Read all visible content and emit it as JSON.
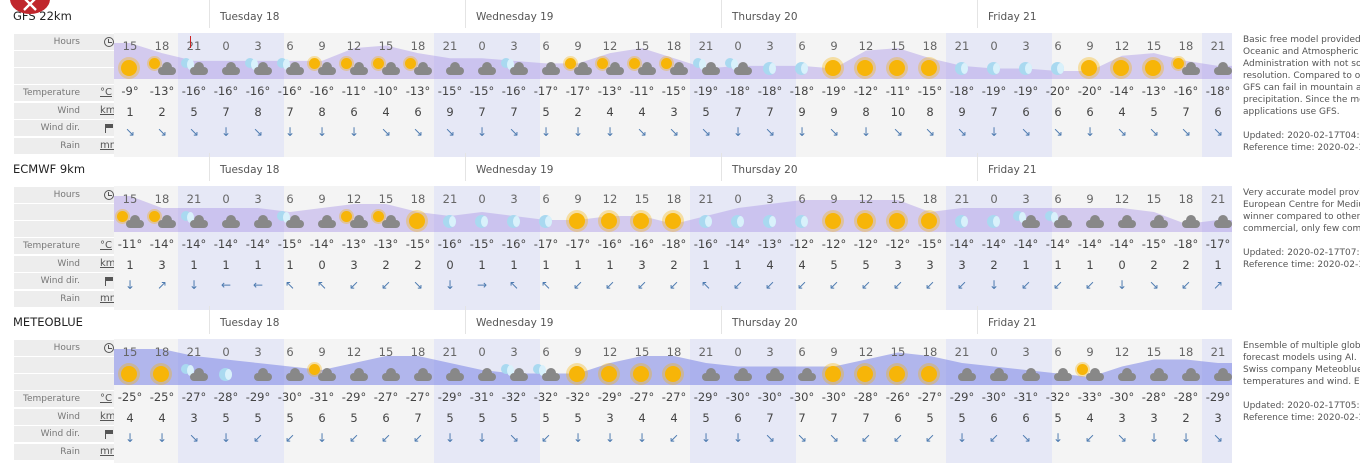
{
  "page": {
    "close_label": "close"
  },
  "days": [
    "Tuesday 18",
    "Wednesday 19",
    "Thursday 20",
    "Friday 21"
  ],
  "labels": {
    "hours": "Hours",
    "temperature": "Temperature",
    "temp_unit": "°C",
    "wind": "Wind",
    "wind_unit": "km/h",
    "wind_dir": "Wind dir.",
    "rain": "Rain",
    "rain_unit": "mm"
  },
  "hours": [
    "15",
    "18",
    "21",
    "0",
    "3",
    "6",
    "9",
    "12",
    "15",
    "18",
    "21",
    "0",
    "3",
    "6",
    "9",
    "12",
    "15",
    "18",
    "21",
    "0",
    "3",
    "6",
    "9",
    "12",
    "15",
    "18",
    "21",
    "0",
    "3",
    "6",
    "9",
    "12",
    "15",
    "18",
    "21"
  ],
  "models": [
    {
      "name": "GFS 22km",
      "temps": [
        "-9°",
        "-13°",
        "-16°",
        "-16°",
        "-16°",
        "-16°",
        "-16°",
        "-11°",
        "-10°",
        "-13°",
        "-15°",
        "-15°",
        "-16°",
        "-17°",
        "-17°",
        "-13°",
        "-11°",
        "-15°",
        "-19°",
        "-18°",
        "-18°",
        "-18°",
        "-19°",
        "-12°",
        "-11°",
        "-15°",
        "-18°",
        "-19°",
        "-19°",
        "-20°",
        "-20°",
        "-14°",
        "-13°",
        "-16°",
        "-18°"
      ],
      "wind": [
        "1",
        "2",
        "5",
        "7",
        "8",
        "7",
        "8",
        "6",
        "4",
        "6",
        "9",
        "7",
        "7",
        "5",
        "2",
        "4",
        "4",
        "3",
        "5",
        "7",
        "7",
        "9",
        "9",
        "8",
        "10",
        "8",
        "9",
        "7",
        "6",
        "6",
        "6",
        "4",
        "5",
        "7",
        "6"
      ],
      "icons": [
        "sun",
        "pcd",
        "pcn",
        "cloud",
        "pcn",
        "pcn",
        "pcd",
        "pcd",
        "pcd",
        "pcd",
        "cloud",
        "cloud",
        "pcn",
        "cloud",
        "pcd",
        "pcd",
        "pcd",
        "pcd",
        "pcn",
        "pcn",
        "moon",
        "moon",
        "sun",
        "sun",
        "sun",
        "sun",
        "moon",
        "moon",
        "moon",
        "moon",
        "sun",
        "sun",
        "sun",
        "pcd",
        "cloud"
      ],
      "dirs": [
        "↘",
        "↘",
        "↘",
        "↓",
        "↘",
        "↓",
        "↓",
        "↓",
        "↘",
        "↘",
        "↘",
        "↓",
        "↘",
        "↓",
        "↓",
        "↓",
        "↘",
        "↘",
        "↘",
        "↓",
        "↘",
        "↓",
        "↘",
        "↓",
        "↘",
        "↘",
        "↘",
        "↓",
        "↘",
        "↘",
        "↓",
        "↘",
        "↘",
        "↘",
        "↘"
      ],
      "description": [
        "Basic free model provided",
        "Oceanic and Atmospheric",
        "Administration with not so",
        "resolution. Compared to ot",
        "GFS can fail in mountain ar",
        "precipitation. Since the mo",
        "applications use GFS."
      ],
      "updated": "Updated: 2020-02-17T04:",
      "reference": "Reference time: 2020-02-1"
    },
    {
      "name": "ECMWF 9km",
      "temps": [
        "-11°",
        "-14°",
        "-14°",
        "-14°",
        "-14°",
        "-15°",
        "-14°",
        "-13°",
        "-13°",
        "-15°",
        "-16°",
        "-15°",
        "-16°",
        "-17°",
        "-17°",
        "-16°",
        "-16°",
        "-18°",
        "-16°",
        "-14°",
        "-13°",
        "-12°",
        "-12°",
        "-12°",
        "-12°",
        "-15°",
        "-14°",
        "-14°",
        "-14°",
        "-14°",
        "-14°",
        "-14°",
        "-15°",
        "-18°",
        "-17°"
      ],
      "wind": [
        "1",
        "3",
        "1",
        "1",
        "1",
        "1",
        "0",
        "3",
        "2",
        "2",
        "0",
        "1",
        "1",
        "1",
        "1",
        "1",
        "3",
        "2",
        "1",
        "1",
        "4",
        "4",
        "5",
        "5",
        "3",
        "3",
        "3",
        "2",
        "1",
        "1",
        "1",
        "0",
        "2",
        "2",
        "1"
      ],
      "icons": [
        "pcd",
        "pcd",
        "pcn",
        "cloud",
        "cloud",
        "pcn",
        "cloud",
        "pcd",
        "pcd",
        "sun",
        "moon",
        "moon",
        "moon",
        "moon",
        "sun",
        "sun",
        "sun",
        "sun",
        "moon",
        "moon",
        "moon",
        "moon",
        "sun",
        "sun",
        "sun",
        "sun",
        "moon",
        "moon",
        "pcn",
        "pcn",
        "cloud",
        "cloud",
        "cloud",
        "cloud",
        "cloud"
      ],
      "dirs": [
        "↓",
        "↗",
        "↓",
        "←",
        "←",
        "↖",
        "↖",
        "↙",
        "↙",
        "↘",
        "↓",
        "→",
        "↖",
        "↖",
        "↙",
        "↙",
        "↙",
        "↙",
        "↖",
        "↙",
        "↙",
        "↙",
        "↙",
        "↙",
        "↙",
        "↙",
        "↙",
        "↓",
        "↙",
        "↙",
        "↙",
        "↓",
        "↘",
        "↙",
        "↗"
      ],
      "description": [
        "Very accurate model provi",
        "European Centre for Mediu",
        "winner compared to other",
        "commercial, only few comp"
      ],
      "updated": "Updated: 2020-02-17T07:",
      "reference": "Reference time: 2020-02-1"
    },
    {
      "name": "METEOBLUE",
      "temps": [
        "-25°",
        "-25°",
        "-27°",
        "-28°",
        "-29°",
        "-30°",
        "-31°",
        "-29°",
        "-27°",
        "-27°",
        "-29°",
        "-31°",
        "-32°",
        "-32°",
        "-32°",
        "-29°",
        "-27°",
        "-27°",
        "-29°",
        "-30°",
        "-30°",
        "-30°",
        "-30°",
        "-28°",
        "-26°",
        "-27°",
        "-29°",
        "-30°",
        "-31°",
        "-32°",
        "-33°",
        "-30°",
        "-28°",
        "-28°",
        "-29°"
      ],
      "wind": [
        "4",
        "4",
        "3",
        "5",
        "5",
        "5",
        "6",
        "5",
        "6",
        "7",
        "5",
        "5",
        "5",
        "5",
        "5",
        "3",
        "4",
        "4",
        "5",
        "6",
        "7",
        "7",
        "7",
        "7",
        "6",
        "5",
        "5",
        "6",
        "6",
        "5",
        "4",
        "3",
        "3",
        "2",
        "3"
      ],
      "icons": [
        "sun",
        "sun",
        "pcn",
        "moon",
        "cloud",
        "cloud",
        "pcd",
        "cloud",
        "cloud",
        "cloud",
        "cloud",
        "cloud",
        "pcn",
        "pcn",
        "sun",
        "sun",
        "sun",
        "sun",
        "cloud",
        "cloud",
        "cloud",
        "cloud",
        "sun",
        "sun",
        "sun",
        "sun",
        "cloud",
        "cloud",
        "cloud",
        "cloud",
        "pcd",
        "cloud",
        "cloud",
        "cloud",
        "cloud"
      ],
      "dirs": [
        "↓",
        "↓",
        "↘",
        "↓",
        "↙",
        "↙",
        "↓",
        "↙",
        "↙",
        "↙",
        "↓",
        "↓",
        "↘",
        "↙",
        "↓",
        "↓",
        "↓",
        "↙",
        "↓",
        "↓",
        "↘",
        "↘",
        "↘",
        "↙",
        "↙",
        "↙",
        "↓",
        "↙",
        "↘",
        "↓",
        "↙",
        "↘",
        "↓",
        "↓",
        "↘"
      ],
      "description": [
        "Ensemble of multiple glob",
        "forecast models using AI. D",
        "Swiss company Meteoblue",
        "temperatures and wind. Ex"
      ],
      "updated": "Updated: 2020-02-17T05:4",
      "reference": "Reference time: 2020-02-1"
    }
  ],
  "colors": {
    "sun": "#f7b508",
    "cloud": "#888888",
    "moon": "#a9d9f0",
    "night_band": "#e6e8f6",
    "wind_arrow": "#4e7bb0",
    "close": "#c0262c"
  }
}
